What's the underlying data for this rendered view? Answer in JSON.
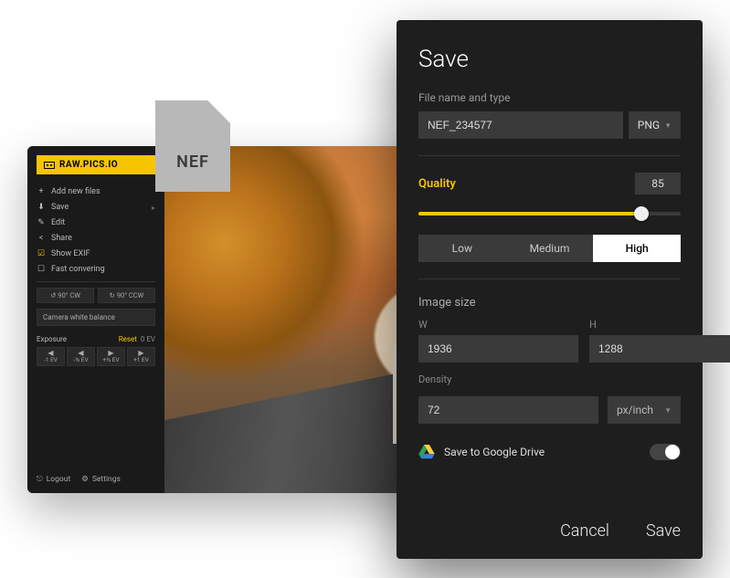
{
  "editor": {
    "logo": "RAW.PICS.IO",
    "menu": {
      "add_files": "Add new files",
      "save": "Save",
      "edit": "Edit",
      "share": "Share",
      "show_exif": "Show EXIF",
      "fast_convering": "Fast convering"
    },
    "rotate": {
      "ccw": "↺ 90° CW",
      "cw": "↻ 90° CCW"
    },
    "white_balance": "Camera white balance",
    "exposure": {
      "label": "Exposure",
      "reset": "Reset",
      "value": "0 EV"
    },
    "ev_steps": [
      {
        "arrow": "◀",
        "amt": "-1 EV"
      },
      {
        "arrow": "◀",
        "amt": "-½ EV"
      },
      {
        "arrow": "▶",
        "amt": "+½ EV"
      },
      {
        "arrow": "▶",
        "amt": "+1 EV"
      }
    ],
    "footer": {
      "logout": "Logout",
      "settings": "Settings"
    }
  },
  "file_badge": {
    "ext": "NEF"
  },
  "save_dialog": {
    "title": "Save",
    "filename_label": "File name and type",
    "filename": "NEF_234577",
    "filetype": "PNG",
    "quality": {
      "label": "Quality",
      "value": "85",
      "low": "Low",
      "medium": "Medium",
      "high": "High"
    },
    "image_size": {
      "label": "Image size",
      "w_label": "W",
      "h_label": "H",
      "w": "1936",
      "h": "1288"
    },
    "density": {
      "label": "Density",
      "value": "72",
      "unit": "px/inch"
    },
    "gdrive": "Save to Google Drive",
    "cancel": "Cancel",
    "save": "Save"
  }
}
